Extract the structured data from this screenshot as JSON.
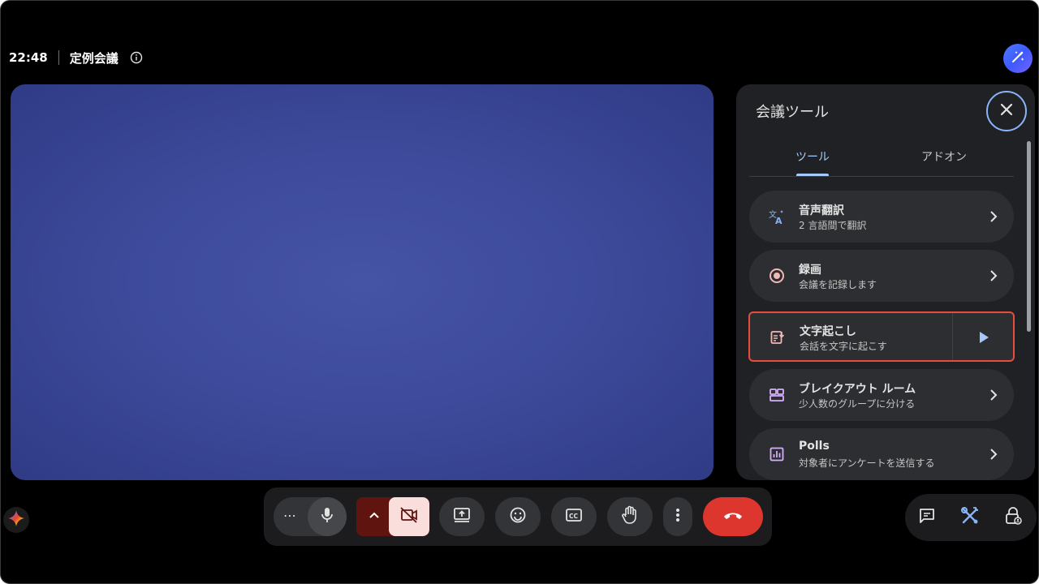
{
  "meeting": {
    "time": "22:48",
    "title": "定例会議"
  },
  "panel": {
    "title": "会議ツール",
    "tabs": [
      {
        "label": "ツール",
        "active": true
      },
      {
        "label": "アドオン",
        "active": false
      }
    ],
    "tools": [
      {
        "name": "音声翻訳",
        "desc": "2 言語間で翻訳",
        "icon": "translate-icon"
      },
      {
        "name": "録画",
        "desc": "会議を記録します",
        "icon": "record-icon"
      },
      {
        "name": "文字起こし",
        "desc": "会話を文字に起こす",
        "icon": "transcript-icon"
      },
      {
        "name": "ブレイクアウト ルーム",
        "desc": "少人数のグループに分ける",
        "icon": "breakout-icon"
      },
      {
        "name": "Polls",
        "desc": "対象者にアンケートを送信する",
        "icon": "poll-icon"
      }
    ]
  },
  "controls": {
    "more_label": "⋯"
  },
  "colors": {
    "accent": "#a8c7fa",
    "hangup": "#dc362e",
    "highlight_border": "#e74c3c",
    "video_bg": "#3e4b9c"
  }
}
